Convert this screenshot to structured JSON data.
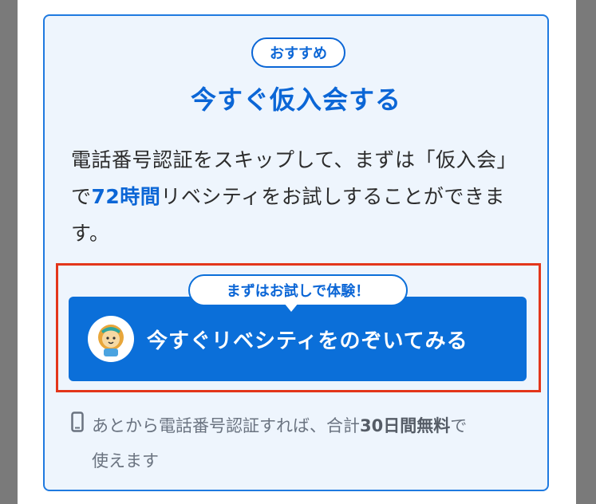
{
  "badge": "おすすめ",
  "title": "今すぐ仮入会する",
  "description": {
    "part1": "電話番号認証をスキップして、まずは「仮入会」で",
    "highlight": "72時間",
    "part2": "リベシティをお試しすることができます。"
  },
  "cta": {
    "bubble": "まずはお試しで体験！",
    "label": "今すぐリベシティをのぞいてみる",
    "avatar_icon": "lion-mascot-icon"
  },
  "note": {
    "icon": "smartphone-icon",
    "part1": "あとから電話番号認証すれば、合計",
    "strong": "30日間無料",
    "part2": "で",
    "line2": "使えます"
  },
  "colors": {
    "accent": "#0b6fd9",
    "highlight_border": "#e3361b",
    "card_bg": "#eef5fd"
  }
}
